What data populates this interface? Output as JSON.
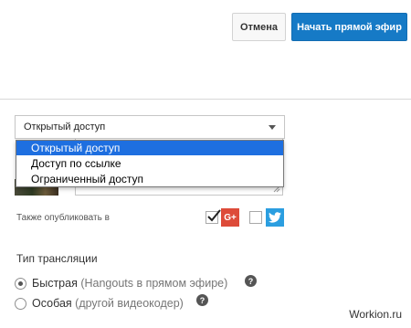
{
  "toolbar": {
    "cancel_label": "Отмена",
    "start_label": "Начать прямой эфир"
  },
  "privacy": {
    "selected": "Открытый доступ",
    "options": [
      "Открытый доступ",
      "Доступ по ссылке",
      "Ограниченный доступ"
    ]
  },
  "share": {
    "label": "Также опубликовать в",
    "gplus_icon": "google-plus-icon",
    "gplus_glyph": "G+",
    "gplus_checked": true,
    "twitter_icon": "twitter-icon",
    "twitter_checked": false
  },
  "stream_type": {
    "title": "Тип трансляции",
    "options": [
      {
        "label": "Быстрая",
        "sub": "(Hangouts в прямом эфире)",
        "selected": true
      },
      {
        "label": "Особая",
        "sub": "(другой видеокодер)",
        "selected": false
      }
    ],
    "help_glyph": "?"
  },
  "watermark": "Workion.ru",
  "colors": {
    "accent": "#167ac6",
    "dropdown_highlight": "#1e6fe0",
    "gplus": "#dd4b39",
    "twitter": "#2b9ee0"
  }
}
